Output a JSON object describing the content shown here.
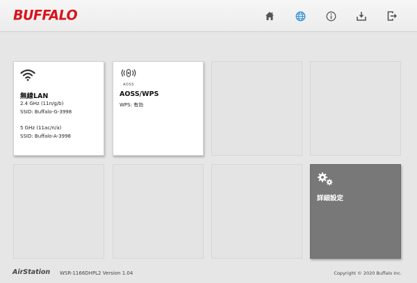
{
  "header": {
    "logo": "BUFFALO",
    "nav": [
      {
        "icon": "home-icon"
      },
      {
        "icon": "globe-icon"
      },
      {
        "icon": "info-icon"
      },
      {
        "icon": "download-icon"
      },
      {
        "icon": "logout-icon"
      }
    ],
    "accent_color": "#2a8fd6",
    "brand_color": "#d8141e"
  },
  "tiles": {
    "wireless": {
      "icon": "wifi-icon",
      "title": "無線LAN",
      "band1": "2.4 GHz (11n/g/b)",
      "ssid1": "SSID: Buffalo-G-3998",
      "band2": "5 GHz (11ac/n/a)",
      "ssid2": "SSID: Buffalo-A-3998"
    },
    "aoss": {
      "icon": "aoss-icon",
      "icon_label": "AOSS",
      "title": "AOSS/WPS",
      "status": "WPS: 有効"
    },
    "advanced": {
      "icon": "gears-icon",
      "title": "詳細設定"
    }
  },
  "footer": {
    "brand": "AirStation",
    "version": "WSR-1166DHPL2 Version 1.04",
    "copyright": "Copyright © 2020 Buffalo Inc."
  }
}
